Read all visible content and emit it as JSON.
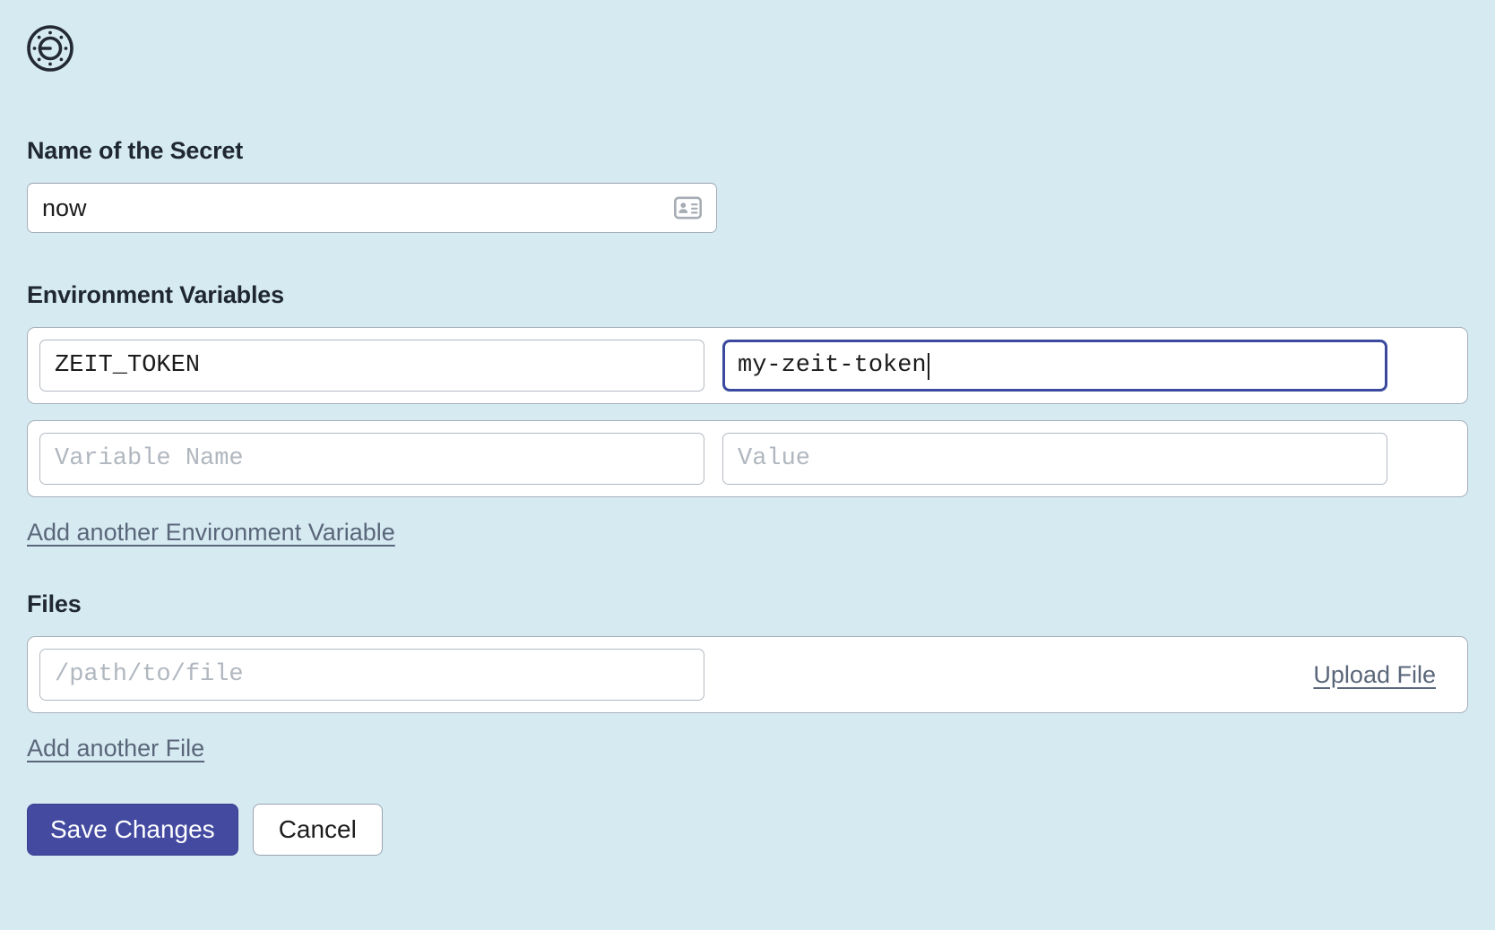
{
  "logo": {
    "icon": "vault-dial-icon"
  },
  "secret_name": {
    "heading": "Name of the Secret",
    "value": "now",
    "placeholder": "",
    "autofill_icon": "contact-card-icon"
  },
  "env_vars": {
    "heading": "Environment Variables",
    "rows": [
      {
        "name_value": "ZEIT_TOKEN",
        "name_placeholder": "Variable Name",
        "value_value": "my-zeit-token",
        "value_placeholder": "Value",
        "focused": "value"
      },
      {
        "name_value": "",
        "name_placeholder": "Variable Name",
        "value_value": "",
        "value_placeholder": "Value",
        "focused": ""
      }
    ],
    "add_link": "Add another Environment Variable"
  },
  "files": {
    "heading": "Files",
    "path_value": "",
    "path_placeholder": "/path/to/file",
    "upload_label": "Upload File",
    "add_link": "Add another File"
  },
  "actions": {
    "save_label": "Save Changes",
    "cancel_label": "Cancel"
  },
  "colors": {
    "background": "#d6eaf2",
    "accent": "#434aa0",
    "focus_border": "#3b4a9e",
    "link": "#5a6679",
    "heading": "#1f2733"
  }
}
